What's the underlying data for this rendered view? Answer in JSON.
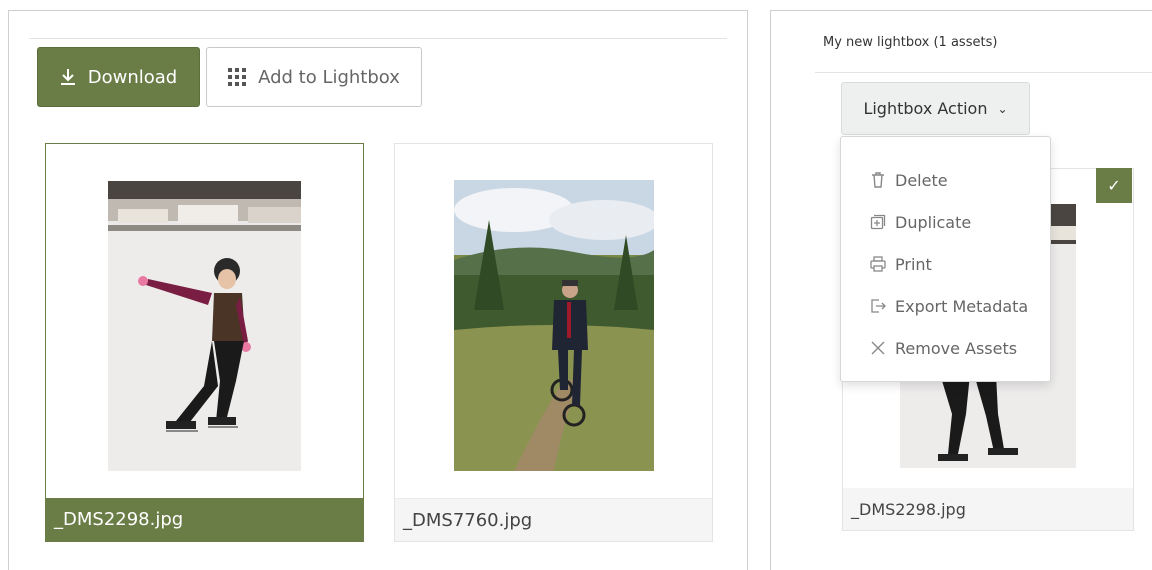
{
  "toolbar": {
    "download_label": "Download",
    "download_icon": "download-icon",
    "add_lightbox_label": "Add to Lightbox",
    "add_lightbox_icon": "grid-icon"
  },
  "assets": [
    {
      "filename": "_DMS2298.jpg",
      "selected": true,
      "image": "girl ice skating"
    },
    {
      "filename": "_DMS7760.jpg",
      "selected": false,
      "image": "man in suit riding bicycle on trail"
    }
  ],
  "lightbox": {
    "title": "My new lightbox (1 assets)",
    "action_label": "Lightbox Action",
    "action_icon": "chevron-down-icon",
    "menu": [
      {
        "label": "Delete",
        "icon": "trash-icon"
      },
      {
        "label": "Duplicate",
        "icon": "duplicate-icon"
      },
      {
        "label": "Print",
        "icon": "print-icon"
      },
      {
        "label": "Export Metadata",
        "icon": "export-icon"
      },
      {
        "label": "Remove Assets",
        "icon": "close-icon"
      }
    ],
    "asset": {
      "filename": "_DMS2298.jpg",
      "checked": true
    }
  },
  "colors": {
    "accent": "#6b7d47",
    "button_gray": "#eef0f0"
  }
}
